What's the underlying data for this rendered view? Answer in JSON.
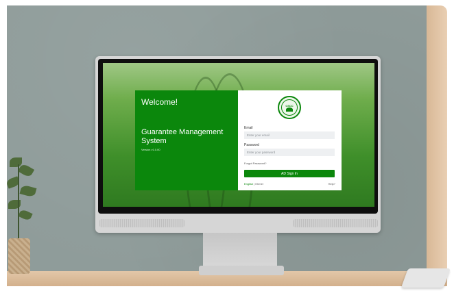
{
  "login": {
    "welcome": "Welcome!",
    "title": "Guarantee Management System",
    "version": "Version v1.0.00",
    "seal_text": "CSCC",
    "email_label": "Email",
    "email_placeholder": "Enter your email",
    "password_label": "Password",
    "password_placeholder": "Enter your password",
    "forgot_link": "Forgot Password?",
    "signin_button": "AD Sign In",
    "lang_en": "English",
    "lang_sep": " | ",
    "lang_khmer": "Khmer",
    "help_link": "Help?"
  },
  "colors": {
    "brand_green": "#0b870c",
    "input_bg": "#eef0f2"
  },
  "icons": {
    "logo": "organization-seal-icon"
  }
}
